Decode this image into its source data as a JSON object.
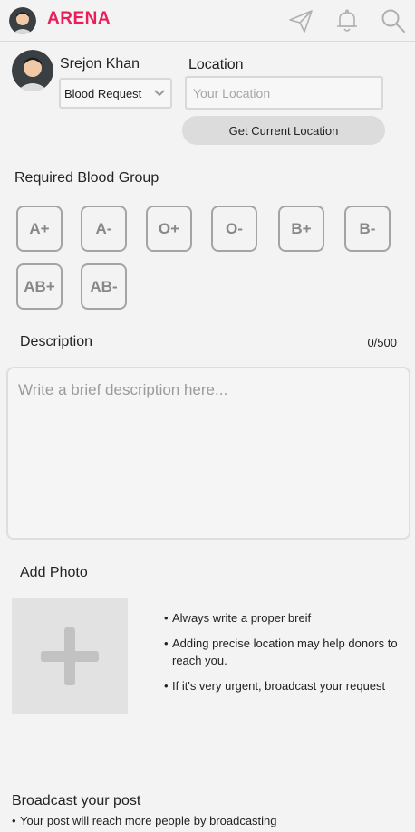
{
  "header": {
    "brand": "ARENA",
    "brand_color": "#e91e5a",
    "icons": [
      "avatar",
      "send-icon",
      "bell-icon",
      "search-icon"
    ]
  },
  "user": {
    "name": "Srejon Khan",
    "post_type": "Blood Request"
  },
  "location": {
    "label": "Location",
    "value": "",
    "placeholder": "Your Location",
    "button_label": "Get Current Location"
  },
  "blood_group": {
    "title": "Required Blood Group",
    "options": [
      "A+",
      "A-",
      "O+",
      "O-",
      "B+",
      "B-",
      "AB+",
      "AB-"
    ]
  },
  "description": {
    "title": "Description",
    "counter": "0/500",
    "value": "",
    "placeholder": "Write a brief description here..."
  },
  "photo": {
    "title": "Add Photo",
    "tips": [
      "Always write a proper breif",
      "Adding precise location may help donors to reach you.",
      "If it's very urgent, broadcast your request"
    ]
  },
  "broadcast": {
    "title": "Broadcast your post",
    "note": "Your post will reach more people by broadcasting"
  }
}
